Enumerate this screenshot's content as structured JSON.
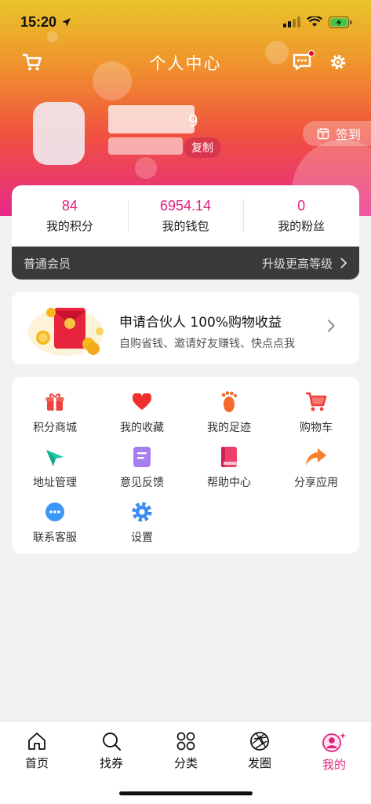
{
  "status_bar": {
    "time": "15:20"
  },
  "header": {
    "title": "个人中心",
    "name_suffix": "9",
    "copy_label": "复制",
    "signin_label": "签到"
  },
  "stats": [
    {
      "value": "84",
      "label": "我的积分"
    },
    {
      "value": "6954.14",
      "label": "我的钱包"
    },
    {
      "value": "0",
      "label": "我的粉丝"
    }
  ],
  "membership": {
    "level": "普通会员",
    "upgrade_label": "升级更高等级"
  },
  "partner": {
    "title": "申请合伙人 100%购物收益",
    "subtitle": "自购省钱、邀请好友赚钱、快点点我"
  },
  "menu": [
    {
      "label": "积分商城",
      "icon": "gift-icon",
      "color": "#f0413c"
    },
    {
      "label": "我的收藏",
      "icon": "heart-icon",
      "color": "#f0302e"
    },
    {
      "label": "我的足迹",
      "icon": "footprint-icon",
      "color": "#f56a2a"
    },
    {
      "label": "购物车",
      "icon": "cart-icon",
      "color": "#f0413c"
    },
    {
      "label": "地址管理",
      "icon": "location-icon",
      "color": "#1fc6a6"
    },
    {
      "label": "意见反馈",
      "icon": "feedback-icon",
      "color": "#a77ef0"
    },
    {
      "label": "帮助中心",
      "icon": "book-icon",
      "color": "#ef3f6a"
    },
    {
      "label": "分享应用",
      "icon": "share-icon",
      "color": "#f5822a"
    },
    {
      "label": "联系客服",
      "icon": "chat-icon",
      "color": "#3b97f5"
    },
    {
      "label": "设置",
      "icon": "settings-icon",
      "color": "#3b8ef0"
    }
  ],
  "tabs": [
    {
      "label": "首页",
      "icon": "home-icon"
    },
    {
      "label": "找券",
      "icon": "search-icon"
    },
    {
      "label": "分类",
      "icon": "category-icon"
    },
    {
      "label": "发圈",
      "icon": "aperture-icon"
    },
    {
      "label": "我的",
      "icon": "user-icon",
      "active": true
    }
  ],
  "colors": {
    "accent": "#e0217c",
    "header_top": "#e8c52a",
    "header_bottom": "#e7298a"
  }
}
